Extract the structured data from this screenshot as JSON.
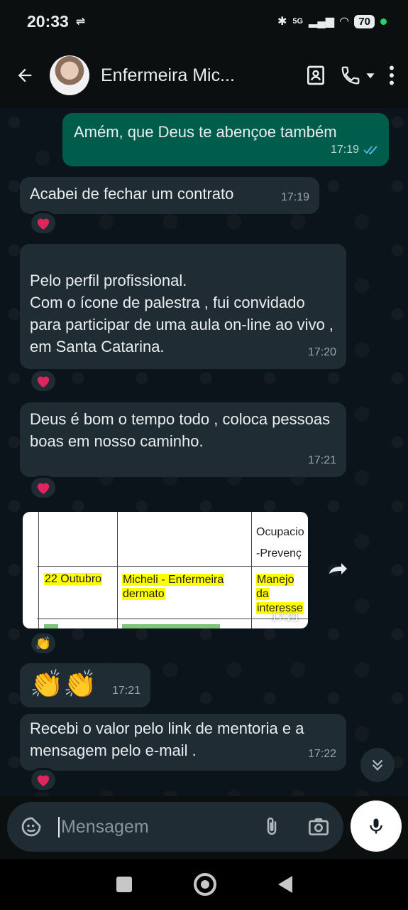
{
  "status_bar": {
    "time": "20:33",
    "network": "5G",
    "battery": "70"
  },
  "header": {
    "contact_name": "Enfermeira Mic..."
  },
  "messages": [
    {
      "text": "Amém, que Deus te abençoe também",
      "time": "17:19",
      "direction": "out",
      "status": "read"
    },
    {
      "text": "Acabei de fechar um contrato",
      "time": "17:19",
      "direction": "in",
      "reaction": "heart"
    },
    {
      "text": "Pelo perfil profissional.\nCom o ícone de palestra , fui convidado para participar de uma aula on-line ao vivo , em Santa Catarina.",
      "time": "17:20",
      "direction": "in",
      "reaction": "heart"
    },
    {
      "text": "Deus é bom o tempo todo , coloca pessoas boas em nosso caminho.",
      "time": "17:21",
      "direction": "in",
      "reaction": "heart"
    },
    {
      "type": "image",
      "time": "17:21",
      "direction": "in",
      "reaction": "clapping",
      "document_cells": {
        "header_c3_line1": "Ocupacio",
        "header_c3_line2": "-Prevenç",
        "date": "22 Outubro",
        "name_line1": "Micheli - Enfermeira",
        "name_line2": "dermato",
        "topic_line1": "Manejo da",
        "topic_line2": "interesse"
      }
    },
    {
      "text": "👏👏",
      "time": "17:21",
      "direction": "in"
    },
    {
      "text": "Recebi o valor pelo link de mentoria e a mensagem pelo e-mail .",
      "time": "17:22",
      "direction": "in",
      "reaction": "heart"
    }
  ],
  "composer": {
    "placeholder": "Mensagem"
  },
  "colors": {
    "incoming_bubble": "#202c33",
    "outgoing_bubble": "#005c4b",
    "heart": "#e0245e",
    "read_ticks": "#53bdeb"
  },
  "icons": [
    "back-arrow-icon",
    "contact-card-icon",
    "phone-icon",
    "dropdown-icon",
    "more-icon",
    "forward-icon",
    "sticker-icon",
    "attach-icon",
    "camera-icon",
    "mic-icon",
    "scroll-down-icon"
  ]
}
